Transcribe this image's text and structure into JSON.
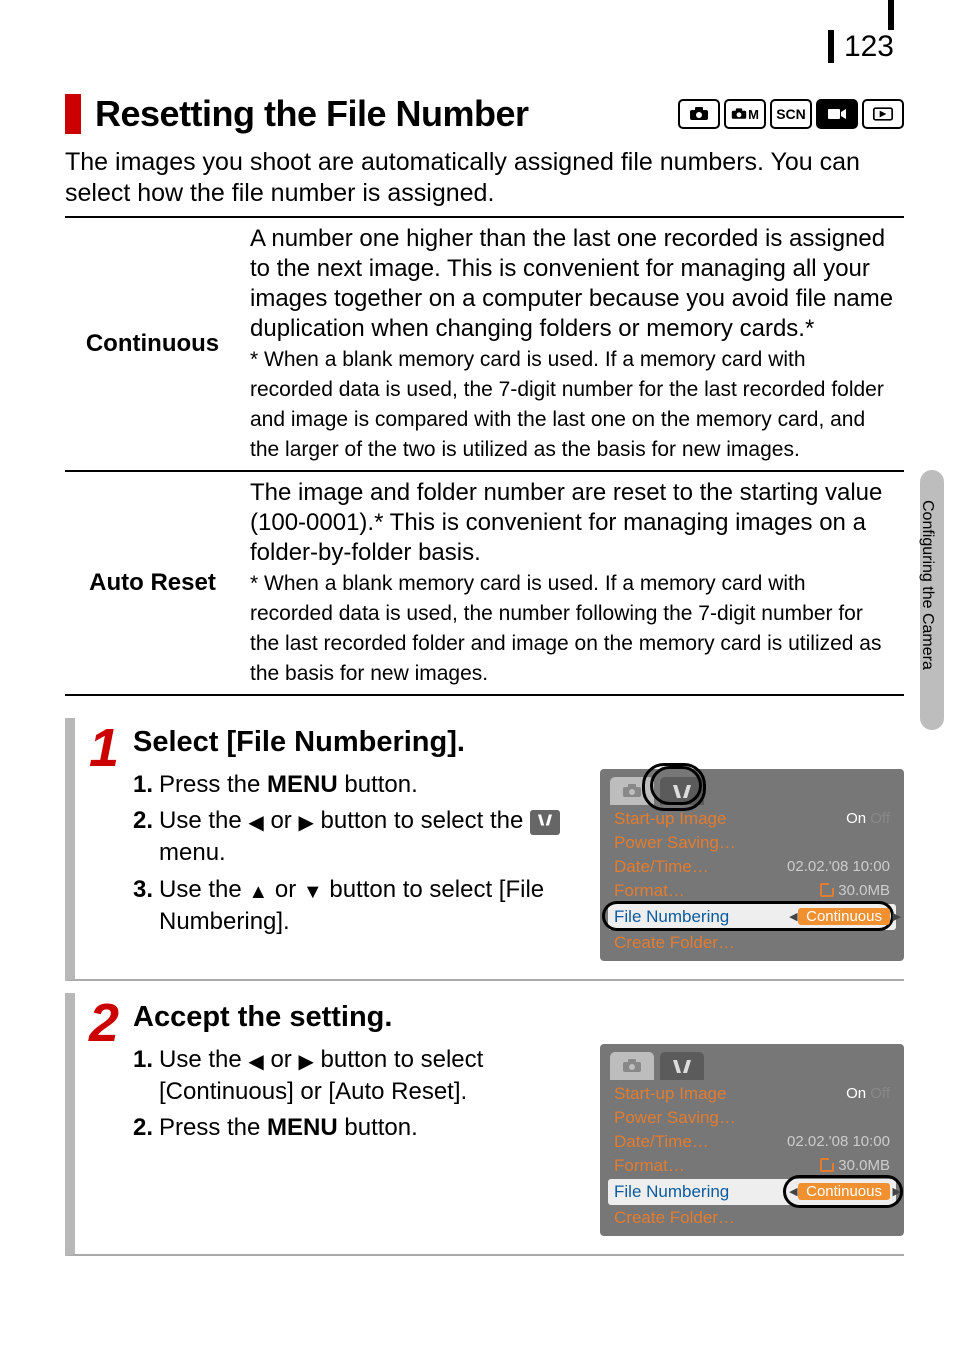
{
  "page_number": "123",
  "side_tab": "Configuring the Camera",
  "title": "Resetting the File Number",
  "mode_icons": [
    "camera-auto",
    "camera-manual",
    "scn",
    "movie",
    "playback"
  ],
  "mode_labels": [
    "",
    "M",
    "SCN",
    "",
    ""
  ],
  "intro": "The images you shoot are automatically assigned file numbers. You can select how the file number is assigned.",
  "options": [
    {
      "name": "Continuous",
      "desc": "A number one higher than the last one recorded is assigned to the next image. This is convenient for managing all your images together on a computer because you avoid file name duplication when changing folders or memory cards.*",
      "note": "* When a blank memory card is used. If a memory card with recorded data is used, the 7-digit number for the last recorded folder and image is compared with the last one on the memory card, and the larger of the two is utilized as the basis for new images."
    },
    {
      "name": "Auto Reset",
      "desc": "The image and folder number are reset to the starting value (100-0001).* This is convenient for managing images on a folder-by-folder basis.",
      "note": "* When a blank memory card is used. If a memory card with recorded data is used, the number following the 7-digit number for the last recorded folder and image on the memory card is utilized as the basis for new images."
    }
  ],
  "steps": [
    {
      "n": "1",
      "title": "Select [File Numbering].",
      "lines": [
        {
          "num": "1.",
          "parts": [
            "Press the ",
            {
              "b": "MENU"
            },
            " button."
          ]
        },
        {
          "num": "2.",
          "parts": [
            "Use the ",
            {
              "tri": "◀"
            },
            " or ",
            {
              "tri": "▶"
            },
            " button to select the ",
            {
              "tool": true
            },
            " menu."
          ]
        },
        {
          "num": "3.",
          "parts": [
            "Use the ",
            {
              "tri": "▲"
            },
            " or ",
            {
              "tri": "▼"
            },
            " button to select [File Numbering]."
          ]
        }
      ]
    },
    {
      "n": "2",
      "title": "Accept the setting.",
      "lines": [
        {
          "num": "1.",
          "parts": [
            "Use the ",
            {
              "tri": "◀"
            },
            " or ",
            {
              "tri": "▶"
            },
            " button to select [Continuous] or [Auto Reset]."
          ]
        },
        {
          "num": "2.",
          "parts": [
            "Press the ",
            {
              "b": "MENU"
            },
            " button."
          ]
        }
      ]
    }
  ],
  "screen": {
    "tabs": [
      "camera",
      "tools"
    ],
    "rows": [
      {
        "label": "Start-up Image",
        "val_on": "On",
        "val_off": "Off"
      },
      {
        "label": "Power Saving…",
        "val": ""
      },
      {
        "label": "Date/Time…",
        "val": "02.02.'08 10:00"
      },
      {
        "label": "Format…",
        "val": "30.0MB",
        "card": true
      },
      {
        "label": "File Numbering",
        "pill": "Continuous",
        "hl": true
      },
      {
        "label": "Create Folder…",
        "val": ""
      }
    ]
  }
}
